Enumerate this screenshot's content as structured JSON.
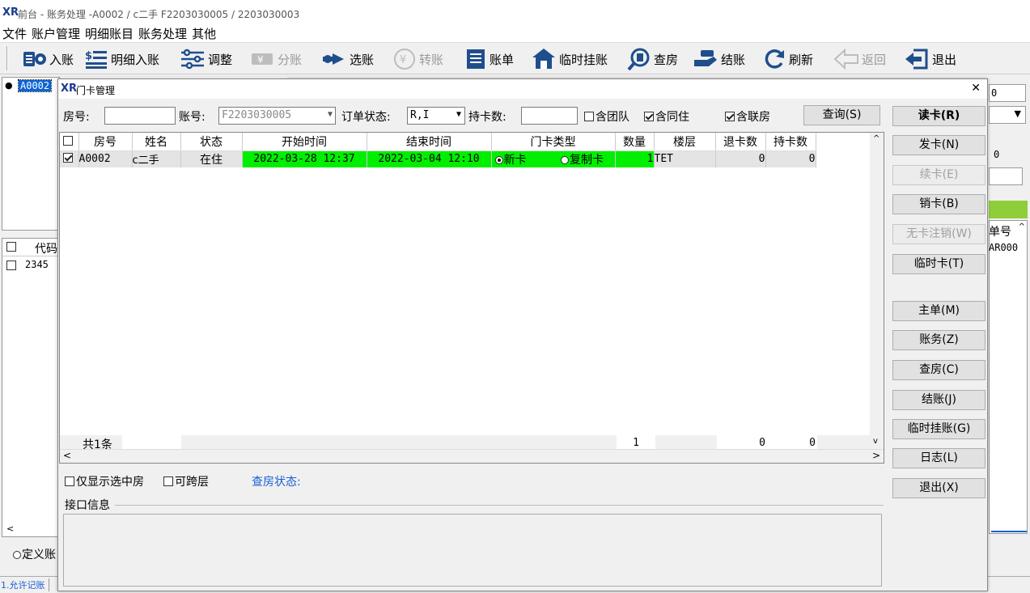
{
  "window": {
    "logo": "XR",
    "title": "前台 - 账务处理 -A0002  /  c二手  F2203030005  /  2203030003"
  },
  "menu": [
    "文件",
    "账户管理",
    "明细账目",
    "账务处理",
    "其他"
  ],
  "toolbar": [
    {
      "label": "入账",
      "icon": "entry-icon",
      "enabled": true
    },
    {
      "label": "明细入账",
      "icon": "detail-entry-icon",
      "enabled": true
    },
    {
      "label": "调整",
      "icon": "adjust-icon",
      "enabled": true
    },
    {
      "label": "分账",
      "icon": "split-icon",
      "enabled": false
    },
    {
      "label": "选账",
      "icon": "select-account-icon",
      "enabled": true
    },
    {
      "label": "转账",
      "icon": "transfer-icon",
      "enabled": false
    },
    {
      "label": "账单",
      "icon": "bill-icon",
      "enabled": true
    },
    {
      "label": "临时挂账",
      "icon": "temp-charge-icon",
      "enabled": true
    },
    {
      "label": "查房",
      "icon": "room-check-icon",
      "enabled": true
    },
    {
      "label": "结账",
      "icon": "checkout-icon",
      "enabled": true
    },
    {
      "label": "刷新",
      "icon": "refresh-icon",
      "enabled": true
    },
    {
      "label": "返回",
      "icon": "back-icon",
      "enabled": false
    },
    {
      "label": "退出",
      "icon": "exit-icon",
      "enabled": true
    }
  ],
  "background": {
    "tree_item": "A0002",
    "list_header": "代码",
    "list_value": "2345",
    "radio_label": "定义账",
    "right_header": "单号",
    "right_value": "AR000",
    "right_val0": "0",
    "right_val1": "0",
    "status_item": "1.允许记账"
  },
  "dialog": {
    "logo": "XR",
    "title": "门卡管理",
    "close": "✕",
    "filters": {
      "room_label": "房号:",
      "room_value": "",
      "account_label": "账号:",
      "account_value": "F2203030005",
      "order_status_label": "订单状态:",
      "order_status_value": "R,I",
      "card_count_label": "持卡数:",
      "card_count_value": "",
      "include_group": "含团队",
      "include_group_checked": false,
      "include_cohabit": "含同住",
      "include_cohabit_checked": true,
      "include_linked": "含联房",
      "include_linked_checked": true,
      "query_button": "查询(S)"
    },
    "columns": [
      "房号",
      "姓名",
      "状态",
      "开始时间",
      "结束时间",
      "门卡类型",
      "数量",
      "楼层",
      "退卡数",
      "持卡数"
    ],
    "rows": [
      {
        "checked": true,
        "room": "A0002",
        "name": "c二手",
        "status": "在住",
        "start": "2022-03-28 12:37",
        "end": "2022-03-04 12:10",
        "card_type_new": "新卡",
        "card_type_copy": "复制卡",
        "card_type_selected": "新卡",
        "qty": "1",
        "floor": "TET",
        "returned": "0",
        "holding": "0"
      }
    ],
    "footer": {
      "count": "共1条",
      "qty_total": "1",
      "returned_total": "0",
      "holding_total": "0"
    },
    "options": {
      "only_selected": "仅显示选中房",
      "cross_floor": "可跨层",
      "room_check_status": "查房状态:"
    },
    "interface_label": "接口信息",
    "buttons": [
      {
        "label": "读卡(R)",
        "enabled": true,
        "bold": true
      },
      {
        "label": "发卡(N)",
        "enabled": true
      },
      {
        "label": "续卡(E)",
        "enabled": false
      },
      {
        "label": "销卡(B)",
        "enabled": true
      },
      {
        "label": "无卡注销(W)",
        "enabled": false
      },
      {
        "label": "临时卡(T)",
        "enabled": true
      },
      {
        "label": "主单(M)",
        "enabled": true
      },
      {
        "label": "账务(Z)",
        "enabled": true
      },
      {
        "label": "查房(C)",
        "enabled": true
      },
      {
        "label": "结账(J)",
        "enabled": true
      },
      {
        "label": "临时挂账(G)",
        "enabled": true
      },
      {
        "label": "日志(L)",
        "enabled": true
      },
      {
        "label": "退出(X)",
        "enabled": true
      }
    ]
  },
  "colors": {
    "active_green": "#00ee00",
    "link_blue": "#1a5fd6",
    "brand": "#1b3a8f",
    "bg_green": "#8fce3a"
  }
}
